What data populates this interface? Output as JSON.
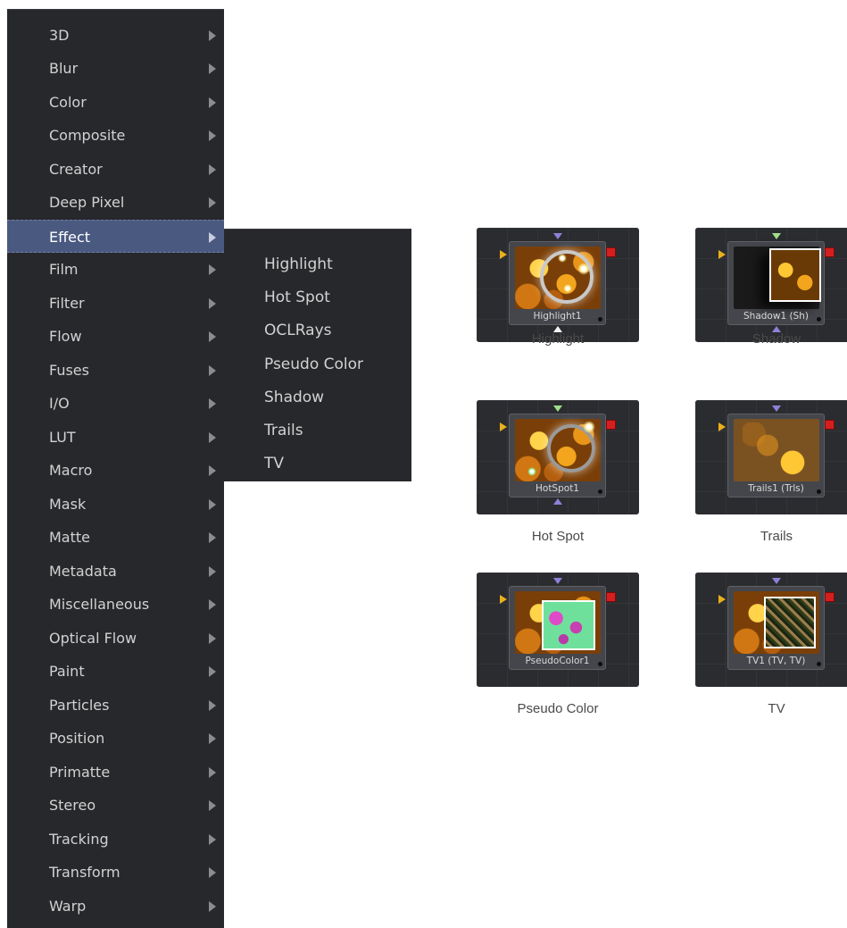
{
  "menu": {
    "items": [
      {
        "label": "3D"
      },
      {
        "label": "Blur"
      },
      {
        "label": "Color"
      },
      {
        "label": "Composite"
      },
      {
        "label": "Creator"
      },
      {
        "label": "Deep Pixel"
      },
      {
        "label": "Effect",
        "active": true
      },
      {
        "label": "Film"
      },
      {
        "label": "Filter"
      },
      {
        "label": "Flow"
      },
      {
        "label": "Fuses"
      },
      {
        "label": "I/O"
      },
      {
        "label": "LUT"
      },
      {
        "label": "Macro"
      },
      {
        "label": "Mask"
      },
      {
        "label": "Matte"
      },
      {
        "label": "Metadata"
      },
      {
        "label": "Miscellaneous"
      },
      {
        "label": "Optical Flow"
      },
      {
        "label": "Paint"
      },
      {
        "label": "Particles"
      },
      {
        "label": "Position"
      },
      {
        "label": "Primatte"
      },
      {
        "label": "Stereo"
      },
      {
        "label": "Tracking"
      },
      {
        "label": "Transform"
      },
      {
        "label": "Warp"
      }
    ]
  },
  "submenu": {
    "items": [
      {
        "label": "Highlight"
      },
      {
        "label": "Hot Spot"
      },
      {
        "label": "OCLRays"
      },
      {
        "label": "Pseudo Color"
      },
      {
        "label": "Shadow"
      },
      {
        "label": "Trails"
      },
      {
        "label": "TV"
      }
    ]
  },
  "nodes": [
    {
      "id": "highlight",
      "node_label": "Highlight1",
      "caption": "Highlight",
      "icon": "highlight-thumbnail"
    },
    {
      "id": "shadow",
      "node_label": "Shadow1  (Sh)",
      "caption": "Shadow",
      "icon": "shadow-thumbnail"
    },
    {
      "id": "hotspot",
      "node_label": "HotSpot1",
      "caption": "Hot Spot",
      "icon": "hotspot-thumbnail"
    },
    {
      "id": "trails",
      "node_label": "Trails1  (Trls)",
      "caption": "Trails",
      "icon": "trails-thumbnail"
    },
    {
      "id": "pseudocolor",
      "node_label": "PseudoColor1",
      "caption": "Pseudo Color",
      "icon": "pseudocolor-thumbnail"
    },
    {
      "id": "tv",
      "node_label": "TV1  (TV, TV)",
      "caption": "TV",
      "icon": "tv-thumbnail"
    }
  ],
  "colors": {
    "menu_bg": "#27282b",
    "menu_active": "#4a5980",
    "menu_text": "#d2d2d2",
    "input_triangle": "#e9b01b",
    "output_square": "#d41f1f"
  }
}
